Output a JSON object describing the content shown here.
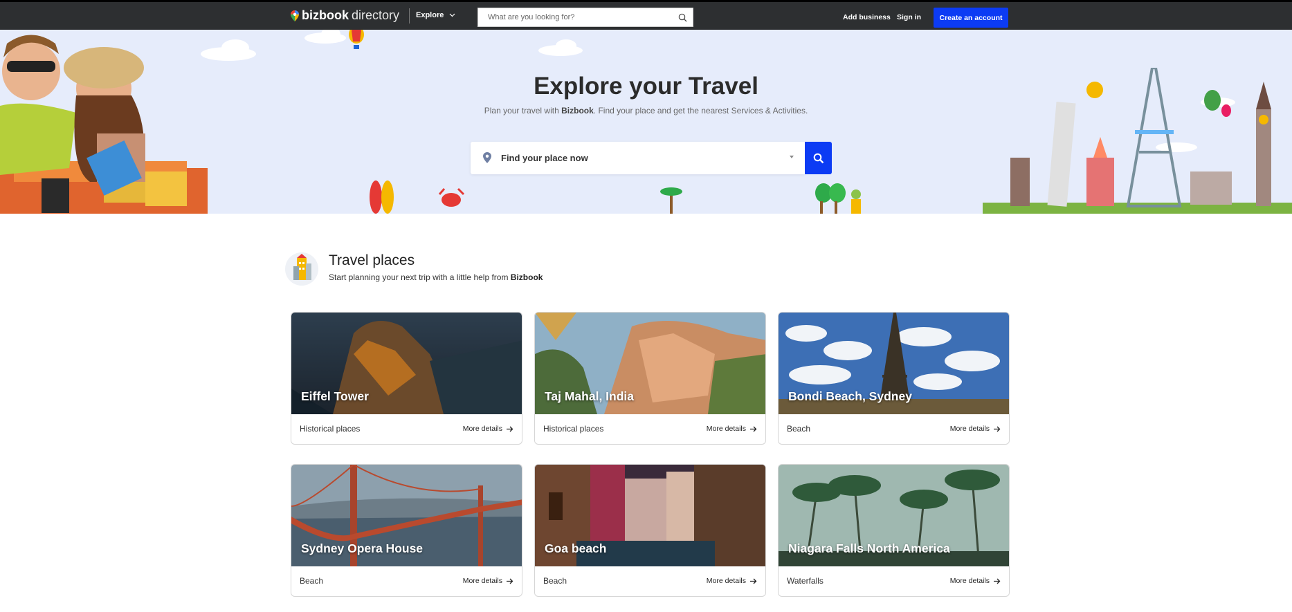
{
  "header": {
    "logo_bold": "bizbook",
    "logo_thin": "directory",
    "explore_label": "Explore",
    "search_placeholder": "What are you looking for?",
    "add_business": "Add business",
    "sign_in": "Sign in",
    "create_account": "Create an account"
  },
  "hero": {
    "title": "Explore your Travel",
    "subtitle_prefix": "Plan your travel with ",
    "subtitle_brand": "Bizbook",
    "subtitle_suffix": ". Find your place and get the nearest Services & Activities.",
    "search_placeholder": "Find your place now"
  },
  "section": {
    "title": "Travel places",
    "subtitle_prefix": "Start planning your next trip with a little help from ",
    "subtitle_brand": "Bizbook"
  },
  "cards": [
    {
      "name": "Eiffel Tower",
      "category": "Historical places",
      "more": "More details"
    },
    {
      "name": "Taj Mahal, India",
      "category": "Historical places",
      "more": "More details"
    },
    {
      "name": "Bondi Beach, Sydney",
      "category": "Beach",
      "more": "More details"
    },
    {
      "name": "Sydney Opera House",
      "category": "Beach",
      "more": "More details"
    },
    {
      "name": "Goa beach",
      "category": "Beach",
      "more": "More details"
    },
    {
      "name": "Niagara Falls North America",
      "category": "Waterfalls",
      "more": "More details"
    }
  ],
  "colors": {
    "topbar": "#2d2f31",
    "accent": "#0c3bf4",
    "hero_bg": "#e6ecfb"
  }
}
